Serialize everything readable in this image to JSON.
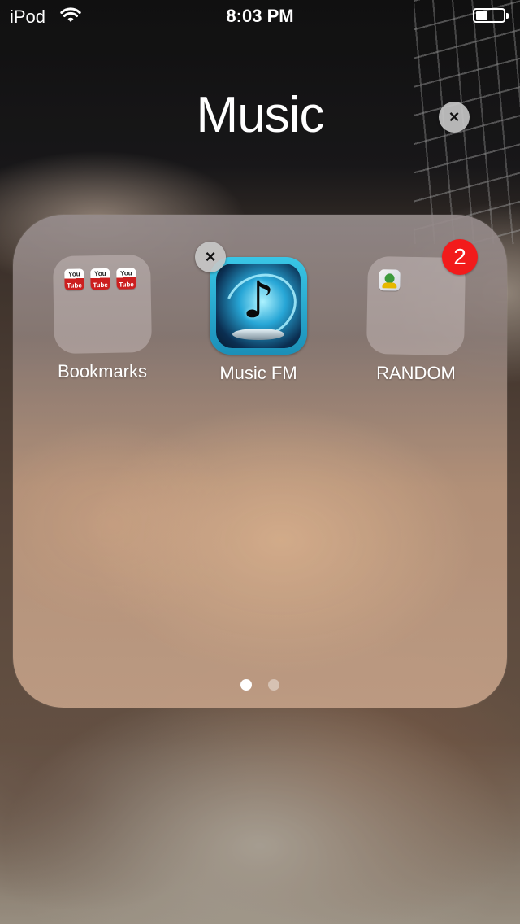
{
  "status_bar": {
    "carrier": "iPod",
    "time": "8:03 PM",
    "wifi_icon": "wifi-icon",
    "battery_icon": "battery-icon",
    "battery_level": 0.45
  },
  "folder": {
    "title": "Music",
    "close_icon": "×",
    "apps": [
      {
        "label": "Bookmarks",
        "type": "folder",
        "contents": [
          "YouTube",
          "YouTube",
          "YouTube"
        ]
      },
      {
        "label": "Music FM",
        "type": "app",
        "delete_icon": "×"
      },
      {
        "label": "RANDOM",
        "type": "folder",
        "badge": "2",
        "contents": [
          "contacts-icon"
        ]
      }
    ],
    "page_count": 2,
    "current_page": 1
  },
  "youtube_icon_text": {
    "top": "You",
    "bottom": "Tube"
  },
  "colors": {
    "badge": "#f21b1b",
    "musicfm_accent": "#39c6e6"
  }
}
